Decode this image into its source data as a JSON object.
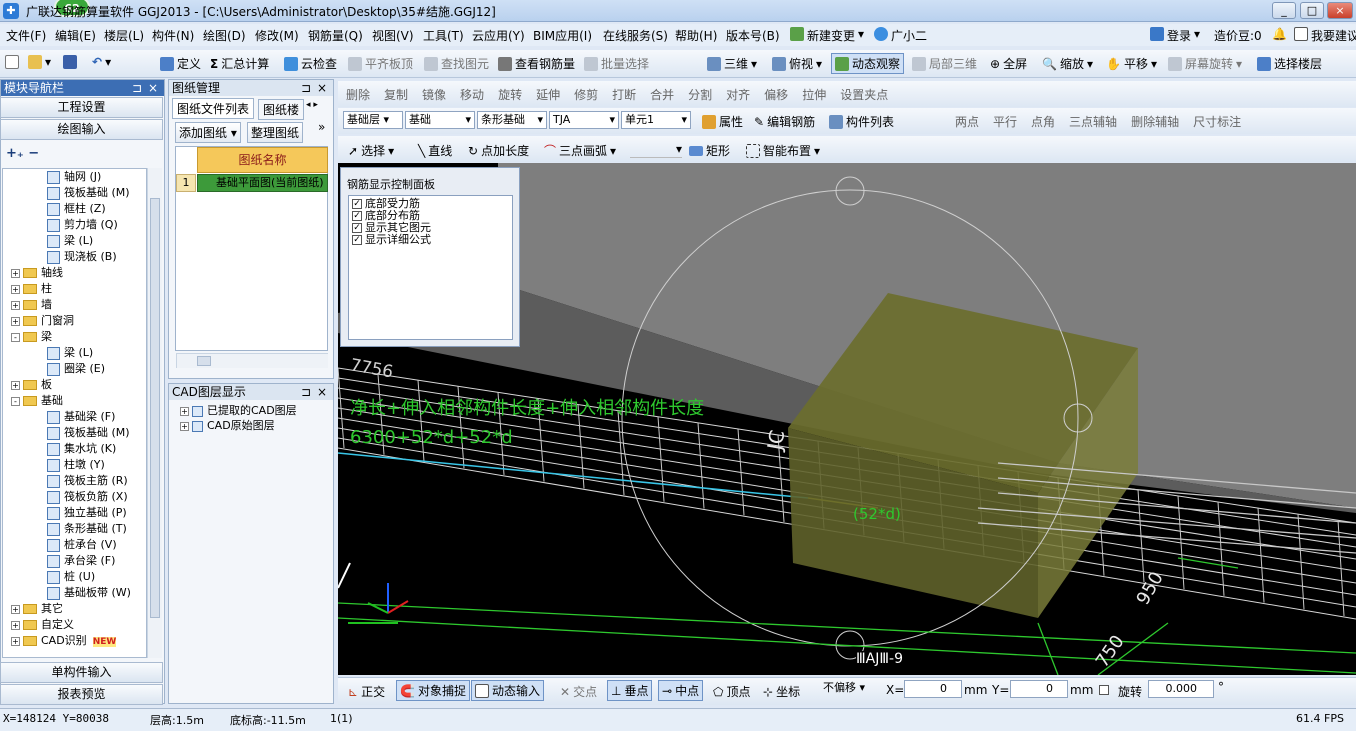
{
  "window": {
    "title": "广联达钢筋算量软件 GGJ2013 - [C:\\Users\\Administrator\\Desktop\\35#结施.GGJ12]",
    "badge": "62",
    "controls": [
      "_",
      "□",
      "×"
    ]
  },
  "menu": [
    "文件(F)",
    "编辑(E)",
    "楼层(L)",
    "构件(N)",
    "绘图(D)",
    "修改(M)",
    "钢筋量(Q)",
    "视图(V)",
    "工具(T)",
    "云应用(Y)",
    "BIM应用(I)",
    "在线服务(S)",
    "帮助(H)",
    "版本号(B)",
    "新建变更",
    "广小二"
  ],
  "menu_right": {
    "login": "登录",
    "price": "造价豆:0",
    "suggest": "我要建议"
  },
  "toolbar1": [
    "定义",
    "汇总计算",
    "云检查",
    "平齐板顶",
    "查找图元",
    "查看钢筋量",
    "批量选择"
  ],
  "toolbar1_right": [
    "三维",
    "俯视",
    "动态观察",
    "局部三维",
    "全屏",
    "缩放",
    "平移",
    "屏幕旋转",
    "选择楼层"
  ],
  "toolbar2": [
    "删除",
    "复制",
    "镜像",
    "移动",
    "旋转",
    "延伸",
    "修剪",
    "打断",
    "合并",
    "分割",
    "对齐",
    "偏移",
    "拉伸",
    "设置夹点"
  ],
  "toolbar3": {
    "floor": "基础层",
    "category": "基础",
    "type": "条形基础",
    "name": "TJA",
    "unit": "单元1",
    "buttons": [
      "属性",
      "编辑钢筋",
      "构件列表"
    ],
    "right": [
      "两点",
      "平行",
      "点角",
      "三点辅轴",
      "删除辅轴",
      "尺寸标注"
    ]
  },
  "toolbar4": [
    "选择",
    "直线",
    "点加长度",
    "三点画弧",
    "矩形",
    "智能布置"
  ],
  "nav": {
    "title": "模块导航栏",
    "top_buttons": [
      "工程设置",
      "绘图输入"
    ],
    "bottom_buttons": [
      "单构件输入",
      "报表预览"
    ],
    "tree": [
      {
        "label": "轴网 (J)",
        "level": 2,
        "kind": "leaf"
      },
      {
        "label": "筏板基础 (M)",
        "level": 2,
        "kind": "leaf"
      },
      {
        "label": "框柱 (Z)",
        "level": 2,
        "kind": "leaf"
      },
      {
        "label": "剪力墙 (Q)",
        "level": 2,
        "kind": "leaf"
      },
      {
        "label": "梁 (L)",
        "level": 2,
        "kind": "leaf"
      },
      {
        "label": "现浇板 (B)",
        "level": 2,
        "kind": "leaf"
      },
      {
        "label": "轴线",
        "level": 1,
        "kind": "folder",
        "sign": "+"
      },
      {
        "label": "柱",
        "level": 1,
        "kind": "folder",
        "sign": "+"
      },
      {
        "label": "墙",
        "level": 1,
        "kind": "folder",
        "sign": "+"
      },
      {
        "label": "门窗洞",
        "level": 1,
        "kind": "folder",
        "sign": "+"
      },
      {
        "label": "梁",
        "level": 1,
        "kind": "folder",
        "sign": "-"
      },
      {
        "label": "梁 (L)",
        "level": 2,
        "kind": "leaf"
      },
      {
        "label": "圈梁 (E)",
        "level": 2,
        "kind": "leaf"
      },
      {
        "label": "板",
        "level": 1,
        "kind": "folder",
        "sign": "+"
      },
      {
        "label": "基础",
        "level": 1,
        "kind": "folder",
        "sign": "-"
      },
      {
        "label": "基础梁 (F)",
        "level": 2,
        "kind": "leaf"
      },
      {
        "label": "筏板基础 (M)",
        "level": 2,
        "kind": "leaf"
      },
      {
        "label": "集水坑 (K)",
        "level": 2,
        "kind": "leaf"
      },
      {
        "label": "柱墩 (Y)",
        "level": 2,
        "kind": "leaf"
      },
      {
        "label": "筏板主筋 (R)",
        "level": 2,
        "kind": "leaf"
      },
      {
        "label": "筏板负筋 (X)",
        "level": 2,
        "kind": "leaf"
      },
      {
        "label": "独立基础 (P)",
        "level": 2,
        "kind": "leaf"
      },
      {
        "label": "条形基础 (T)",
        "level": 2,
        "kind": "leaf"
      },
      {
        "label": "桩承台 (V)",
        "level": 2,
        "kind": "leaf"
      },
      {
        "label": "承台梁 (F)",
        "level": 2,
        "kind": "leaf"
      },
      {
        "label": "桩 (U)",
        "level": 2,
        "kind": "leaf"
      },
      {
        "label": "基础板带 (W)",
        "level": 2,
        "kind": "leaf"
      },
      {
        "label": "其它",
        "level": 1,
        "kind": "folder",
        "sign": "+"
      },
      {
        "label": "自定义",
        "level": 1,
        "kind": "folder",
        "sign": "+"
      },
      {
        "label": "CAD识别",
        "level": 1,
        "kind": "folder",
        "sign": "+",
        "new": "NEW"
      }
    ]
  },
  "drawing_panel": {
    "title": "图纸管理",
    "tabs": [
      "图纸文件列表",
      "图纸楼"
    ],
    "buttons": [
      "添加图纸",
      "整理图纸"
    ],
    "column": "图纸名称",
    "rows": [
      {
        "no": "1",
        "name": "基础平面图(当前图纸)"
      }
    ]
  },
  "cad_panel": {
    "title": "CAD图层显示",
    "items": [
      "已提取的CAD图层",
      "CAD原始图层"
    ]
  },
  "control_panel": {
    "title": "钢筋显示控制面板",
    "items": [
      "底部受力筋",
      "底部分布筋",
      "显示其它图元",
      "显示详细公式"
    ]
  },
  "viewport": {
    "formula_text": "净长+伸入相邻构件长度+伸入相邻构件长度",
    "formula_value": "6300+52*d+52*d",
    "label_52d": "(52*d)",
    "dim_7756": "7756",
    "dim_950": "950",
    "dim_750": "750",
    "axis_label": "ⅢAJⅢ-9",
    "side_label": "JC"
  },
  "bottom_toolbar": {
    "buttons": [
      "正交",
      "对象捕捉",
      "动态输入",
      "交点",
      "垂点",
      "中点",
      "顶点",
      "坐标"
    ],
    "offset": "不偏移",
    "x_label": "X=",
    "x_value": "0",
    "y_label": "Y=",
    "y_value": "0",
    "unit": "mm",
    "rotate_label": "旋转",
    "rotate_value": "0.000"
  },
  "status": {
    "coords": "X=148124 Y=80038",
    "floor_height": "层高:1.5m",
    "base_height": "底标高:-11.5m",
    "count": "1(1)",
    "fps": "61.4 FPS"
  },
  "colors": {
    "navy": "#3c6eb4",
    "formula_green": "#2ec82e",
    "block": "#6b6e2e",
    "grid_white": "#d8d8d8"
  }
}
